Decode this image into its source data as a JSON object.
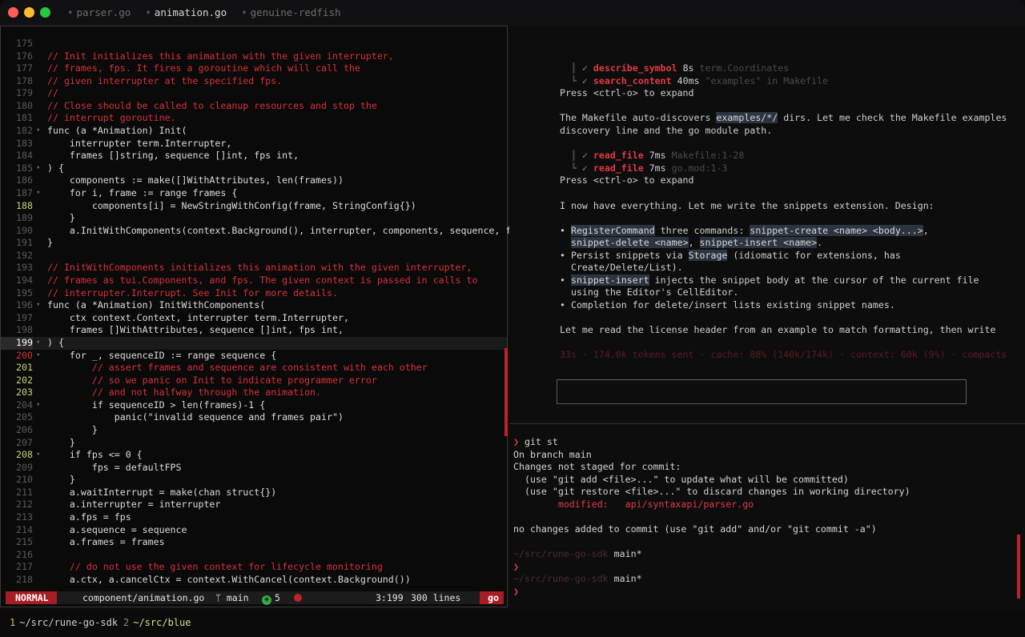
{
  "tabs": [
    {
      "label": "parser.go",
      "active": false
    },
    {
      "label": "animation.go",
      "active": true
    },
    {
      "label": "genuine-redfish",
      "active": false
    }
  ],
  "editor": {
    "lines": [
      {
        "n": "175",
        "t": "",
        "c": false
      },
      {
        "n": "176",
        "t": "// Init initializes this animation with the given interrupter,",
        "c": true
      },
      {
        "n": "177",
        "t": "// frames, fps. It fires a goroutine which will call the",
        "c": true
      },
      {
        "n": "178",
        "t": "// given interrupter at the specified fps.",
        "c": true
      },
      {
        "n": "179",
        "t": "//",
        "c": true
      },
      {
        "n": "180",
        "t": "// Close should be called to cleanup resources and stop the",
        "c": true
      },
      {
        "n": "181",
        "t": "// interrupt goroutine.",
        "c": true
      },
      {
        "n": "182",
        "t": "func (a *Animation) Init(",
        "c": false,
        "f": true
      },
      {
        "n": "183",
        "t": "    interrupter term.Interrupter,",
        "c": false
      },
      {
        "n": "184",
        "t": "    frames []string, sequence []int, fps int,",
        "c": false
      },
      {
        "n": "185",
        "t": ") {",
        "c": false,
        "f": true
      },
      {
        "n": "186",
        "t": "    components := make([]WithAttributes, len(frames))",
        "c": false
      },
      {
        "n": "187",
        "t": "    for i, frame := range frames {",
        "c": false,
        "f": true
      },
      {
        "n": "188",
        "t": "        components[i] = NewStringWithConfig(frame, StringConfig{})",
        "c": false,
        "h": true
      },
      {
        "n": "189",
        "t": "    }",
        "c": false
      },
      {
        "n": "190",
        "t": "    a.InitWithComponents(context.Background(), interrupter, components, sequence, fps)",
        "c": false
      },
      {
        "n": "191",
        "t": "}",
        "c": false
      },
      {
        "n": "192",
        "t": "",
        "c": false
      },
      {
        "n": "193",
        "t": "// InitWithComponents initializes this animation with the given interrupter,",
        "c": true
      },
      {
        "n": "194",
        "t": "// frames as tui.Components, and fps. The given context is passed in calls to",
        "c": true
      },
      {
        "n": "195",
        "t": "// interrupter.Interrupt. See Init for more details.",
        "c": true
      },
      {
        "n": "196",
        "t": "func (a *Animation) InitWithComponents(",
        "c": false,
        "f": true
      },
      {
        "n": "197",
        "t": "    ctx context.Context, interrupter term.Interrupter,",
        "c": false
      },
      {
        "n": "198",
        "t": "    frames []WithAttributes, sequence []int, fps int,",
        "c": false
      },
      {
        "n": "199",
        "t": ") {",
        "c": false,
        "f": true,
        "cur": true
      },
      {
        "n": "200",
        "t": "    for _, sequenceID := range sequence {",
        "c": false,
        "f": true,
        "red": true
      },
      {
        "n": "201",
        "t": "        // assert frames and sequence are consistent with each other",
        "c": true,
        "h": true
      },
      {
        "n": "202",
        "t": "        // so we panic on Init to indicate programmer error",
        "c": true,
        "h": true
      },
      {
        "n": "203",
        "t": "        // and not halfway through the animation.",
        "c": true,
        "h": true
      },
      {
        "n": "204",
        "t": "        if sequenceID > len(frames)-1 {",
        "c": false,
        "f": true
      },
      {
        "n": "205",
        "t": "            panic(\"invalid sequence and frames pair\")",
        "c": false
      },
      {
        "n": "206",
        "t": "        }",
        "c": false
      },
      {
        "n": "207",
        "t": "    }",
        "c": false
      },
      {
        "n": "208",
        "t": "    if fps <= 0 {",
        "c": false,
        "f": true,
        "h": true
      },
      {
        "n": "209",
        "t": "        fps = defaultFPS",
        "c": false
      },
      {
        "n": "210",
        "t": "    }",
        "c": false
      },
      {
        "n": "211",
        "t": "    a.waitInterrupt = make(chan struct{})",
        "c": false
      },
      {
        "n": "212",
        "t": "    a.interrupter = interrupter",
        "c": false
      },
      {
        "n": "213",
        "t": "    a.fps = fps",
        "c": false
      },
      {
        "n": "214",
        "t": "    a.sequence = sequence",
        "c": false
      },
      {
        "n": "215",
        "t": "    a.frames = frames",
        "c": false
      },
      {
        "n": "216",
        "t": "",
        "c": false
      },
      {
        "n": "217",
        "t": "    // do not use the given context for lifecycle monitoring",
        "c": true
      },
      {
        "n": "218",
        "t": "    a.ctx, a.cancelCtx = context.WithCancel(context.Background())",
        "c": false
      }
    ],
    "status": {
      "mode": "NORMAL",
      "file": "component/animation.go",
      "branch": "ᛘ main",
      "added": "5",
      "plus": "+",
      "position": "3:199",
      "lines": "300 lines",
      "lang": "go"
    }
  },
  "agent": {
    "tool1": "describe_symbol",
    "tool1_time": "8s",
    "tool1_arg": "term.Coordinates",
    "tool2": "search_content",
    "tool2_time": "40ms",
    "tool2_arg": "\"examples\" in Makefile",
    "expand1": "Press <ctrl-o> to expand",
    "para1a": "The Makefile auto-discovers ",
    "para1code": "examples/*/",
    "para1b": " dirs. Let me check the Makefile examples",
    "para1c": "discovery line and the go module path.",
    "tool3": "read_file",
    "tool3_time": "7ms",
    "tool3_arg": "Makefile:1-28",
    "tool4": "read_file",
    "tool4_time": "7ms",
    "tool4_arg": "go.mod:1-3",
    "expand2": "Press <ctrl-o> to expand",
    "para2": "I now have everything. Let me write the snippets extension. Design:",
    "b1a": "RegisterCommand",
    "b1b": " three commands: ",
    "b1c": "snippet-create <name> <body...>",
    "b1d": ",",
    "b1e": "snippet-delete <name>",
    "b1f": ", ",
    "b1g": "snippet-insert <name>",
    "b1h": ".",
    "b2a": "Persist snippets via ",
    "b2b": "Storage",
    "b2c": " (idiomatic for extensions, has",
    "b2d": "Create/Delete/List).",
    "b3a": "snippet-insert",
    "b3b": " injects the snippet body at the cursor of the current file",
    "b3c": "using the Editor's CellEditor.",
    "b4": "Completion for delete/insert lists existing snippet names.",
    "para3": "Let me read the license header from an example to match formatting, then write",
    "stats": "33s · 174.0k tokens sent · cache: 88% (140k/174k) · context: 60k (9%) · compacts",
    "input_value": ""
  },
  "terminal": {
    "cmd": "git st",
    "l1": "On branch main",
    "l2": "Changes not staged for commit:",
    "l3": "  (use \"git add <file>...\" to update what will be committed)",
    "l4": "  (use \"git restore <file>...\" to discard changes in working directory)",
    "l5a": "        modified:   ",
    "l5b": "api/syntaxapi/parser.go",
    "l6": "no changes added to commit (use \"git add\" and/or \"git commit -a\")",
    "p1path": "~/src/rune-go-sdk",
    "p1branch": " main*",
    "p2path": "~/src/rune-go-sdk",
    "p2branch": " main*",
    "prompt_glyph": "❯"
  },
  "workspaces": [
    {
      "n": "1",
      "path": "~/src/rune-go-sdk"
    },
    {
      "n": "2",
      "path": "~/src/blue"
    }
  ],
  "colors": {
    "accent": "#c0222b",
    "comment": "#d9303a",
    "highlight": "#c8d37a"
  }
}
